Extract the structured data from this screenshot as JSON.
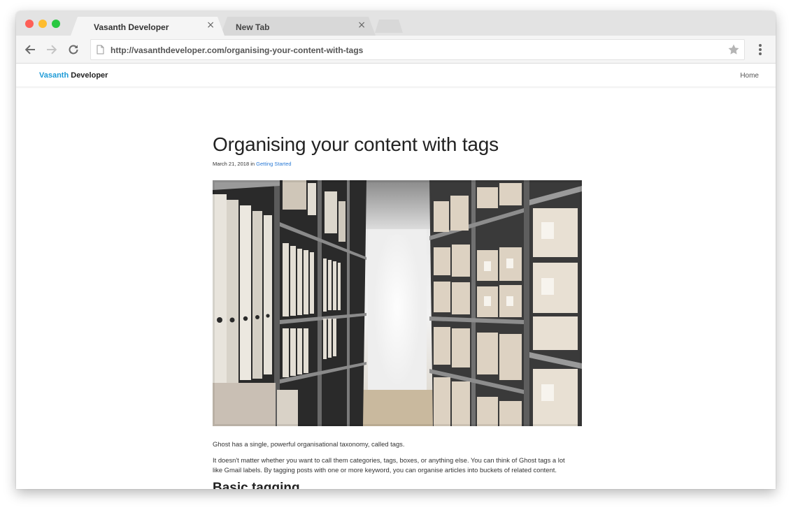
{
  "browser": {
    "tabs": [
      {
        "label": "Vasanth Developer",
        "close": "×"
      },
      {
        "label": "New Tab",
        "close": "×"
      }
    ],
    "url": "http://vasanthdeveloper.com/organising-your-content-with-tags",
    "icons": {
      "back": "back-arrow-icon",
      "forward": "forward-arrow-icon",
      "reload": "reload-icon",
      "page": "page-icon",
      "bookmark": "star-icon",
      "menu": "kebab-menu-icon"
    },
    "colors": {
      "close": "#fe5f57",
      "minimize": "#febc2e",
      "maximize": "#28c840"
    }
  },
  "site": {
    "brand_first": "Vasanth",
    "brand_second": "Developer",
    "brand_color": "#1e9bd7",
    "nav": {
      "home": "Home"
    }
  },
  "post": {
    "title": "Organising your content with tags",
    "date": "March 21, 2018",
    "in_word": "in",
    "category": "Getting Started",
    "category_color": "#2a7ad6",
    "paragraphs": [
      "Ghost has a single, powerful organisational taxonomy, called tags.",
      "It doesn't matter whether you want to call them categories, tags, boxes, or anything else. You can think of Ghost tags a lot like Gmail labels. By tagging posts with one or more keyword, you can organise articles into buckets of related content."
    ],
    "heading": "Basic tagging"
  }
}
